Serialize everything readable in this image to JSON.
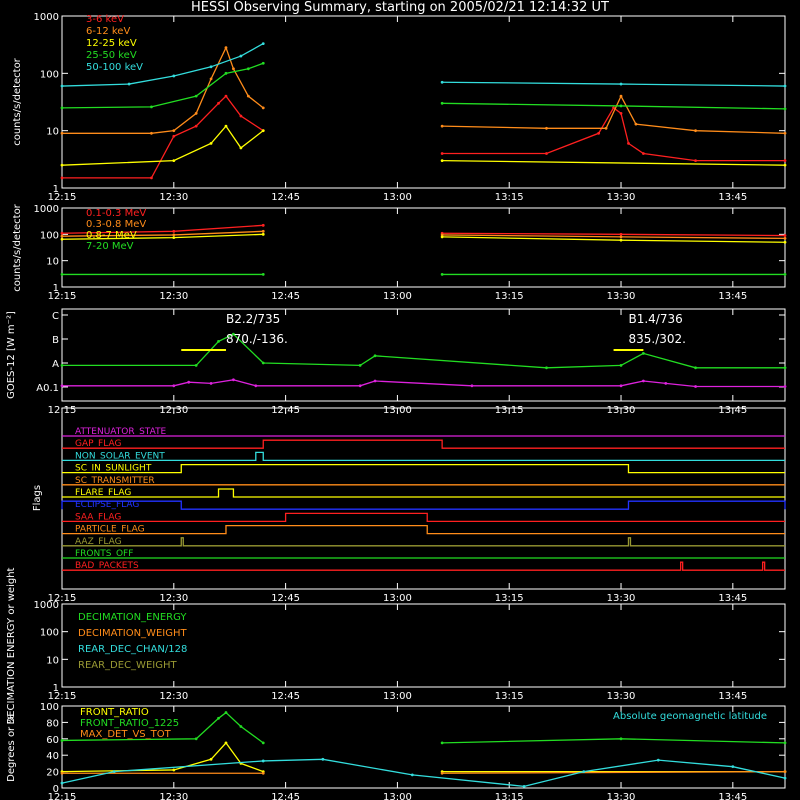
{
  "title": "HESSI Observing Summary, starting on 2005/02/21 12:14:32 UT",
  "colors": {
    "background": "#000000",
    "axes": "#ffffff",
    "red": "#ff2020",
    "orange": "#ff8c1a",
    "yellow": "#ffff00",
    "green": "#22dd22",
    "cyan": "#33dddd",
    "magenta": "#dd22dd",
    "blue": "#2233ff",
    "olive": "#999933"
  },
  "x_tick_labels": [
    "12:15",
    "12:30",
    "12:45",
    "13:00",
    "13:15",
    "13:30",
    "13:45"
  ],
  "chart_data": [
    {
      "id": "lightcurves",
      "type": "line",
      "ylabel": "counts/s/detector",
      "y_scale": "log",
      "ylim": [
        1,
        1000
      ],
      "y_tick_labels": [
        "1",
        "10",
        "100",
        "1000"
      ],
      "legend_position": "top-left",
      "gap": [
        "12:42",
        "13:06"
      ],
      "series": [
        {
          "name": "3-6 keV",
          "color": "#ff2020",
          "x": [
            "12:15",
            "12:27",
            "12:30",
            "12:33",
            "12:36",
            "12:37",
            "12:39",
            "12:42",
            "13:06",
            "13:20",
            "13:27",
            "13:29",
            "13:30",
            "13:31",
            "13:33",
            "13:40",
            "13:52"
          ],
          "y": [
            1.5,
            1.5,
            8,
            12,
            30,
            40,
            18,
            10,
            4,
            4,
            9,
            25,
            20,
            6,
            4,
            3,
            3
          ]
        },
        {
          "name": "6-12 keV",
          "color": "#ff8c1a",
          "x": [
            "12:15",
            "12:27",
            "12:30",
            "12:33",
            "12:35",
            "12:37",
            "12:38",
            "12:40",
            "12:42",
            "13:06",
            "13:20",
            "13:28",
            "13:30",
            "13:32",
            "13:40",
            "13:52"
          ],
          "y": [
            9,
            9,
            10,
            20,
            80,
            280,
            120,
            40,
            25,
            12,
            11,
            11,
            40,
            13,
            10,
            9
          ]
        },
        {
          "name": "12-25 keV",
          "color": "#ffff00",
          "x": [
            "12:15",
            "12:30",
            "12:35",
            "12:37",
            "12:39",
            "12:42",
            "13:06",
            "13:52"
          ],
          "y": [
            2.5,
            3,
            6,
            12,
            5,
            10,
            3,
            2.5
          ]
        },
        {
          "name": "25-50 keV",
          "color": "#22dd22",
          "x": [
            "12:15",
            "12:27",
            "12:33",
            "12:37",
            "12:40",
            "12:42",
            "13:06",
            "13:30",
            "13:52"
          ],
          "y": [
            25,
            26,
            40,
            100,
            120,
            150,
            30,
            27,
            24
          ]
        },
        {
          "name": "50-100 keV",
          "color": "#33dddd",
          "x": [
            "12:15",
            "12:24",
            "12:30",
            "12:35",
            "12:39",
            "12:42",
            "13:06",
            "13:30",
            "13:52"
          ],
          "y": [
            60,
            65,
            90,
            130,
            200,
            330,
            70,
            65,
            60
          ]
        }
      ]
    },
    {
      "id": "high_energy",
      "type": "line",
      "ylabel": "counts/s/detector",
      "y_scale": "log",
      "ylim": [
        1,
        1000
      ],
      "y_tick_labels": [
        "1",
        "10",
        "100",
        "1000"
      ],
      "legend_position": "top-left",
      "series": [
        {
          "name": "0.1-0.3 MeV",
          "color": "#ff2020",
          "x": [
            "12:15",
            "12:30",
            "12:42",
            "13:06",
            "13:30",
            "13:52"
          ],
          "y": [
            110,
            130,
            220,
            110,
            100,
            90
          ]
        },
        {
          "name": "0.3-0.8 MeV",
          "color": "#ff8c1a",
          "x": [
            "12:15",
            "12:30",
            "12:42",
            "13:06",
            "13:30",
            "13:52"
          ],
          "y": [
            85,
            95,
            130,
            95,
            80,
            70
          ]
        },
        {
          "name": "0.8-7 MeV",
          "color": "#ffff00",
          "x": [
            "12:15",
            "12:30",
            "12:42",
            "13:06",
            "13:30",
            "13:52"
          ],
          "y": [
            65,
            75,
            100,
            80,
            60,
            50
          ]
        },
        {
          "name": "7-20 MeV",
          "color": "#22dd22",
          "x": [
            "12:15",
            "12:42",
            "13:06",
            "13:52"
          ],
          "y": [
            3,
            3,
            3,
            3
          ]
        }
      ]
    },
    {
      "id": "goes",
      "type": "line",
      "ylabel": "GOES-12 [W m⁻²]",
      "y_tick_labels": [
        "C",
        "B",
        "A",
        "A0.1"
      ],
      "annotations": [
        "B2.2/735",
        "870./-136.",
        "B1.4/736",
        "835./302."
      ],
      "series": [
        {
          "name": "GOES high",
          "color": "#22dd22",
          "x": [
            "12:15",
            "12:33",
            "12:36",
            "12:38",
            "12:42",
            "12:55",
            "12:57",
            "13:20",
            "13:30",
            "13:33",
            "13:40",
            "13:52"
          ],
          "y": [
            0.9,
            0.9,
            1.9,
            2.2,
            1.0,
            0.9,
            1.3,
            0.8,
            0.9,
            1.4,
            0.8,
            0.8
          ]
        },
        {
          "name": "GOES low",
          "color": "#dd22dd",
          "x": [
            "12:15",
            "12:30",
            "12:32",
            "12:35",
            "12:38",
            "12:41",
            "12:55",
            "12:57",
            "13:10",
            "13:30",
            "13:33",
            "13:36",
            "13:40",
            "13:52"
          ],
          "y": [
            0.05,
            0.05,
            0.2,
            0.15,
            0.3,
            0.05,
            0.05,
            0.25,
            0.05,
            0.05,
            0.25,
            0.15,
            0.02,
            0.02
          ]
        }
      ]
    },
    {
      "id": "flags",
      "type": "line",
      "ylabel": "Flags",
      "flags": [
        {
          "name": "ATTENUATOR_STATE",
          "color": "#dd22dd",
          "on": []
        },
        {
          "name": "GAP_FLAG",
          "color": "#ff2020",
          "on": [
            [
              "12:42",
              "13:06"
            ]
          ]
        },
        {
          "name": "NON_SOLAR_EVENT",
          "color": "#33dddd",
          "on": [
            [
              "12:41",
              "12:42"
            ]
          ]
        },
        {
          "name": "SC_IN_SUNLIGHT",
          "color": "#ffff00",
          "on": [
            [
              "12:31",
              "13:31"
            ]
          ]
        },
        {
          "name": "SC_TRANSMITTER",
          "color": "#ff8c1a",
          "on": []
        },
        {
          "name": "FLARE_FLAG",
          "color": "#ffff00",
          "on": [
            [
              "12:36",
              "12:38"
            ]
          ]
        },
        {
          "name": "ECLIPSE_FLAG",
          "color": "#2233ff",
          "on": [
            [
              "12:15",
              "12:31"
            ],
            [
              "13:31",
              "13:52"
            ]
          ]
        },
        {
          "name": "SAA_FLAG",
          "color": "#ff2020",
          "on": [
            [
              "12:45",
              "13:04"
            ]
          ]
        },
        {
          "name": "PARTICLE_FLAG",
          "color": "#ff8c1a",
          "on": [
            [
              "12:37",
              "13:04"
            ]
          ]
        },
        {
          "name": "AAZ_FLAG",
          "color": "#999933",
          "on": [
            [
              "12:31",
              "12:31"
            ],
            [
              "13:31",
              "13:31"
            ]
          ]
        },
        {
          "name": "FRONTS_OFF",
          "color": "#22dd22",
          "on": []
        },
        {
          "name": "BAD_PACKETS",
          "color": "#ff2020",
          "on": [
            [
              "13:38",
              "13:38"
            ],
            [
              "13:49",
              "13:49"
            ]
          ]
        }
      ]
    },
    {
      "id": "decimation",
      "type": "line",
      "ylabel": "DECIMATION ENERGY or weight",
      "y_scale": "log",
      "ylim": [
        1,
        1000
      ],
      "y_tick_labels": [
        "1",
        "10",
        "100",
        "1000"
      ],
      "legend_position": "top-left",
      "series": [
        {
          "name": "DECIMATION_ENERGY",
          "color": "#22dd22",
          "x": [],
          "y": []
        },
        {
          "name": "DECIMATION_WEIGHT",
          "color": "#ff8c1a",
          "x": [],
          "y": []
        },
        {
          "name": "REAR_DEC_CHAN/128",
          "color": "#33dddd",
          "x": [],
          "y": []
        },
        {
          "name": "REAR_DEC_WEIGHT",
          "color": "#999933",
          "x": [],
          "y": []
        }
      ]
    },
    {
      "id": "ratios",
      "type": "line",
      "ylabel": "Degrees or %",
      "ylim": [
        0,
        100
      ],
      "y_tick_labels": [
        "0",
        "20",
        "40",
        "60",
        "80",
        "100"
      ],
      "annotations": [
        "Absolute geomagnetic latitude"
      ],
      "series": [
        {
          "name": "FRONT_RATIO",
          "color": "#ffff00",
          "x": [
            "12:15",
            "12:30",
            "12:35",
            "12:37",
            "12:39",
            "12:42",
            "13:06",
            "13:52"
          ],
          "y": [
            20,
            22,
            35,
            55,
            30,
            20,
            20,
            20
          ]
        },
        {
          "name": "FRONT_RATIO_1225",
          "color": "#22dd22",
          "x": [
            "12:15",
            "12:33",
            "12:36",
            "12:37",
            "12:39",
            "12:42",
            "13:06",
            "13:30",
            "13:52"
          ],
          "y": [
            58,
            60,
            85,
            92,
            75,
            55,
            55,
            60,
            55
          ]
        },
        {
          "name": "MAX_DET_VS_TOT",
          "color": "#ff8c1a",
          "x": [
            "12:15",
            "12:42",
            "13:06",
            "13:52"
          ],
          "y": [
            18,
            18,
            18,
            20
          ]
        },
        {
          "name": "Absolute geomagnetic latitude",
          "color": "#33dddd",
          "x": [
            "12:15",
            "12:22",
            "12:42",
            "12:50",
            "13:02",
            "13:17",
            "13:25",
            "13:35",
            "13:45",
            "13:52"
          ],
          "y": [
            6,
            20,
            33,
            35,
            16,
            2,
            20,
            34,
            26,
            12
          ]
        }
      ]
    }
  ]
}
